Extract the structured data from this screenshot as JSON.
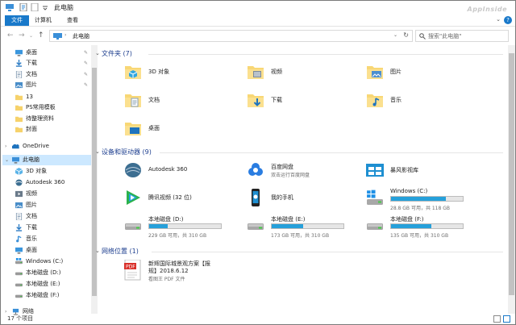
{
  "window": {
    "title": "此电脑",
    "watermark": "AppInside"
  },
  "ribbon": {
    "tabs": [
      "文件",
      "计算机",
      "查看"
    ]
  },
  "address": {
    "path": "此电脑",
    "search_placeholder": "搜索\"此电脑\""
  },
  "sidebar": {
    "items": [
      {
        "label": "桌面",
        "icon": "desktop-icon",
        "pinned": true,
        "color": "#3a96dd"
      },
      {
        "label": "下载",
        "icon": "download-icon",
        "pinned": true,
        "color": "#2b7bc4"
      },
      {
        "label": "文档",
        "icon": "documents-icon",
        "pinned": true,
        "color": "#8aa0b6"
      },
      {
        "label": "图片",
        "icon": "pictures-icon",
        "pinned": true,
        "color": "#4a8ec9"
      },
      {
        "label": "13",
        "icon": "folder-icon",
        "pinned": false,
        "color": "#f6d26b"
      },
      {
        "label": "PS常用模板",
        "icon": "folder-icon",
        "pinned": false,
        "color": "#f6d26b"
      },
      {
        "label": "待整理资料",
        "icon": "folder-icon",
        "pinned": false,
        "color": "#f6d26b"
      },
      {
        "label": "封面",
        "icon": "folder-icon",
        "pinned": false,
        "color": "#f6d26b"
      },
      {
        "label": "OneDrive",
        "icon": "onedrive-icon",
        "pinned": false,
        "color": "#1e73be"
      },
      {
        "label": "此电脑",
        "icon": "this-pc-icon",
        "pinned": false,
        "color": "#3a8fd8",
        "selected": true
      },
      {
        "label": "3D 对象",
        "icon": "3d-objects-icon",
        "pinned": false,
        "color": "#5bb4e8"
      },
      {
        "label": "Autodesk 360",
        "icon": "autodesk-icon",
        "pinned": false,
        "color": "#3c6e91"
      },
      {
        "label": "视频",
        "icon": "videos-icon",
        "pinned": false,
        "color": "#6a7a8a"
      },
      {
        "label": "图片",
        "icon": "pictures-icon",
        "pinned": false,
        "color": "#4a8ec9"
      },
      {
        "label": "文档",
        "icon": "documents-icon",
        "pinned": false,
        "color": "#8aa0b6"
      },
      {
        "label": "下载",
        "icon": "download-icon",
        "pinned": false,
        "color": "#2b7bc4"
      },
      {
        "label": "音乐",
        "icon": "music-icon",
        "pinned": false,
        "color": "#3a8fd8"
      },
      {
        "label": "桌面",
        "icon": "desktop-icon",
        "pinned": false,
        "color": "#3a96dd"
      },
      {
        "label": "Windows (C:)",
        "icon": "drive-c-icon",
        "pinned": false,
        "color": "#6a6a6a"
      },
      {
        "label": "本地磁盘 (D:)",
        "icon": "drive-icon",
        "pinned": false,
        "color": "#6a6a6a"
      },
      {
        "label": "本地磁盘 (E:)",
        "icon": "drive-icon",
        "pinned": false,
        "color": "#6a6a6a"
      },
      {
        "label": "本地磁盘 (F:)",
        "icon": "drive-icon",
        "pinned": false,
        "color": "#6a6a6a"
      },
      {
        "label": "网络",
        "icon": "network-icon",
        "pinned": false,
        "color": "#3a8fd8"
      }
    ]
  },
  "groups": {
    "folders": {
      "title": "文件夹 (7)"
    },
    "devices": {
      "title": "设备和驱动器 (9)"
    },
    "network": {
      "title": "网络位置 (1)"
    }
  },
  "folders": [
    {
      "label": "3D 对象",
      "icon": "3d-objects-icon"
    },
    {
      "label": "视频",
      "icon": "videos-icon"
    },
    {
      "label": "图片",
      "icon": "pictures-icon"
    },
    {
      "label": "文档",
      "icon": "documents-icon"
    },
    {
      "label": "下载",
      "icon": "download-icon"
    },
    {
      "label": "音乐",
      "icon": "music-icon"
    },
    {
      "label": "桌面",
      "icon": "desktop-icon"
    }
  ],
  "devices": [
    {
      "label": "Autodesk 360",
      "sub": "",
      "icon": "autodesk-icon"
    },
    {
      "label": "百度网盘",
      "sub": "双击运行百度网盘",
      "icon": "baidu-netdisk-icon"
    },
    {
      "label": "暴风影视库",
      "sub": "",
      "icon": "baofeng-icon"
    },
    {
      "label": "腾讯视频 (32 位)",
      "sub": "",
      "icon": "tencent-video-icon"
    },
    {
      "label": "我的手机",
      "sub": "",
      "icon": "phone-icon"
    }
  ],
  "drives": [
    {
      "label": "Windows (C:)",
      "free": "28.8 GB 可用，共 118 GB",
      "used_fraction": 0.76,
      "icon": "drive-c-icon"
    },
    {
      "label": "本地磁盘 (D:)",
      "free": "229 GB 可用，共 310 GB",
      "used_fraction": 0.26,
      "icon": "drive-icon"
    },
    {
      "label": "本地磁盘 (E:)",
      "free": "173 GB 可用，共 310 GB",
      "used_fraction": 0.44,
      "icon": "drive-icon"
    },
    {
      "label": "本地磁盘 (F:)",
      "free": "135 GB 可用，共 310 GB",
      "used_fraction": 0.56,
      "icon": "drive-icon"
    }
  ],
  "network_item": {
    "line1": "新辉国际城景观方案【报",
    "line2": "规】2018.6.12",
    "sub": "看图王 PDF 文件",
    "icon": "pdf-icon"
  },
  "status": {
    "count": "17 个项目"
  },
  "colors": {
    "accent": "#1979ca",
    "bar_fill": "#26a0da",
    "selected": "#cce8ff",
    "group_title": "#1e3f8f"
  }
}
